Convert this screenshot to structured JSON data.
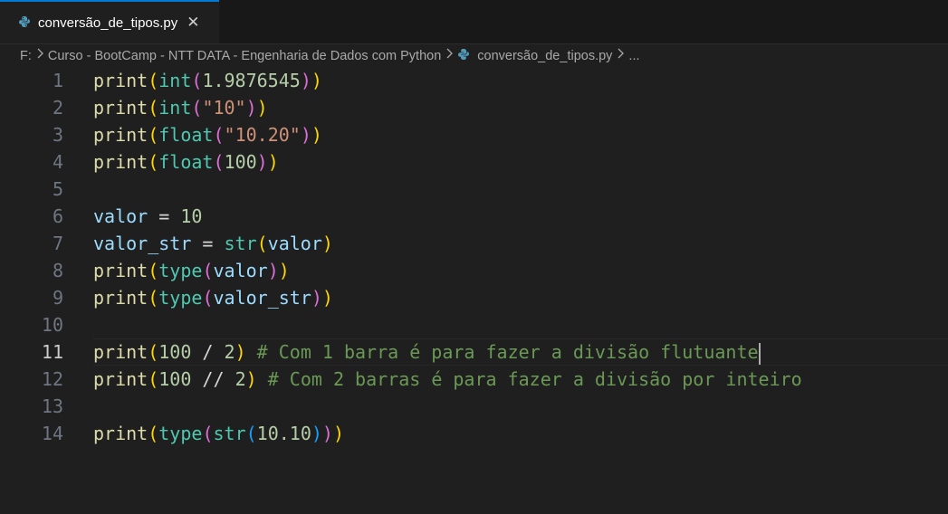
{
  "tab": {
    "label": "conversão_de_tipos.py",
    "close_glyph": "✕",
    "accent": "#0078d4"
  },
  "breadcrumb": {
    "drive": "F:",
    "folder": "Curso - BootCamp - NTT DATA - Engenharia de Dados com Python",
    "file": "conversão_de_tipos.py",
    "more": "..."
  },
  "editor": {
    "current_line": 11,
    "lines": [
      {
        "n": "1",
        "tokens": [
          [
            "print",
            "k-fn"
          ],
          [
            "(",
            "b1"
          ],
          [
            "int",
            "k-cls"
          ],
          [
            "(",
            "b2"
          ],
          [
            "1.9876545",
            "k-num"
          ],
          [
            ")",
            "b2"
          ],
          [
            ")",
            "b1"
          ]
        ]
      },
      {
        "n": "2",
        "tokens": [
          [
            "print",
            "k-fn"
          ],
          [
            "(",
            "b1"
          ],
          [
            "int",
            "k-cls"
          ],
          [
            "(",
            "b2"
          ],
          [
            "\"10\"",
            "k-str"
          ],
          [
            ")",
            "b2"
          ],
          [
            ")",
            "b1"
          ]
        ]
      },
      {
        "n": "3",
        "tokens": [
          [
            "print",
            "k-fn"
          ],
          [
            "(",
            "b1"
          ],
          [
            "float",
            "k-cls"
          ],
          [
            "(",
            "b2"
          ],
          [
            "\"10.20\"",
            "k-str"
          ],
          [
            ")",
            "b2"
          ],
          [
            ")",
            "b1"
          ]
        ]
      },
      {
        "n": "4",
        "tokens": [
          [
            "print",
            "k-fn"
          ],
          [
            "(",
            "b1"
          ],
          [
            "float",
            "k-cls"
          ],
          [
            "(",
            "b2"
          ],
          [
            "100",
            "k-num"
          ],
          [
            ")",
            "b2"
          ],
          [
            ")",
            "b1"
          ]
        ]
      },
      {
        "n": "5",
        "tokens": []
      },
      {
        "n": "6",
        "tokens": [
          [
            "valor",
            "k-var"
          ],
          [
            " = ",
            "k-op"
          ],
          [
            "10",
            "k-num"
          ]
        ]
      },
      {
        "n": "7",
        "tokens": [
          [
            "valor_str",
            "k-var"
          ],
          [
            " = ",
            "k-op"
          ],
          [
            "str",
            "k-cls"
          ],
          [
            "(",
            "b1"
          ],
          [
            "valor",
            "k-var"
          ],
          [
            ")",
            "b1"
          ]
        ]
      },
      {
        "n": "8",
        "tokens": [
          [
            "print",
            "k-fn"
          ],
          [
            "(",
            "b1"
          ],
          [
            "type",
            "k-cls"
          ],
          [
            "(",
            "b2"
          ],
          [
            "valor",
            "k-var"
          ],
          [
            ")",
            "b2"
          ],
          [
            ")",
            "b1"
          ]
        ]
      },
      {
        "n": "9",
        "tokens": [
          [
            "print",
            "k-fn"
          ],
          [
            "(",
            "b1"
          ],
          [
            "type",
            "k-cls"
          ],
          [
            "(",
            "b2"
          ],
          [
            "valor_str",
            "k-var"
          ],
          [
            ")",
            "b2"
          ],
          [
            ")",
            "b1"
          ]
        ]
      },
      {
        "n": "10",
        "tokens": []
      },
      {
        "n": "11",
        "tokens": [
          [
            "print",
            "k-fn"
          ],
          [
            "(",
            "b1"
          ],
          [
            "100",
            "k-num"
          ],
          [
            " / ",
            "k-op"
          ],
          [
            "2",
            "k-num"
          ],
          [
            ")",
            "b1"
          ],
          [
            " # Com 1 barra é para fazer a divisão flutuante",
            "k-com"
          ]
        ]
      },
      {
        "n": "12",
        "tokens": [
          [
            "print",
            "k-fn"
          ],
          [
            "(",
            "b1"
          ],
          [
            "100",
            "k-num"
          ],
          [
            " // ",
            "k-op"
          ],
          [
            "2",
            "k-num"
          ],
          [
            ")",
            "b1"
          ],
          [
            " # Com 2 barras é para fazer a divisão por inteiro",
            "k-com"
          ]
        ]
      },
      {
        "n": "13",
        "tokens": []
      },
      {
        "n": "14",
        "tokens": [
          [
            "print",
            "k-fn"
          ],
          [
            "(",
            "b1"
          ],
          [
            "type",
            "k-cls"
          ],
          [
            "(",
            "b2"
          ],
          [
            "str",
            "k-cls"
          ],
          [
            "(",
            "b3"
          ],
          [
            "10.10",
            "k-num"
          ],
          [
            ")",
            "b3"
          ],
          [
            ")",
            "b2"
          ],
          [
            ")",
            "b1"
          ]
        ]
      }
    ]
  },
  "icons": {
    "python_file": "python-file-icon",
    "chevron": "chevron-right-icon",
    "close": "close-icon"
  },
  "colors": {
    "background": "#1f1f1f",
    "tabbar": "#181818",
    "python_icon": "#519aba"
  }
}
